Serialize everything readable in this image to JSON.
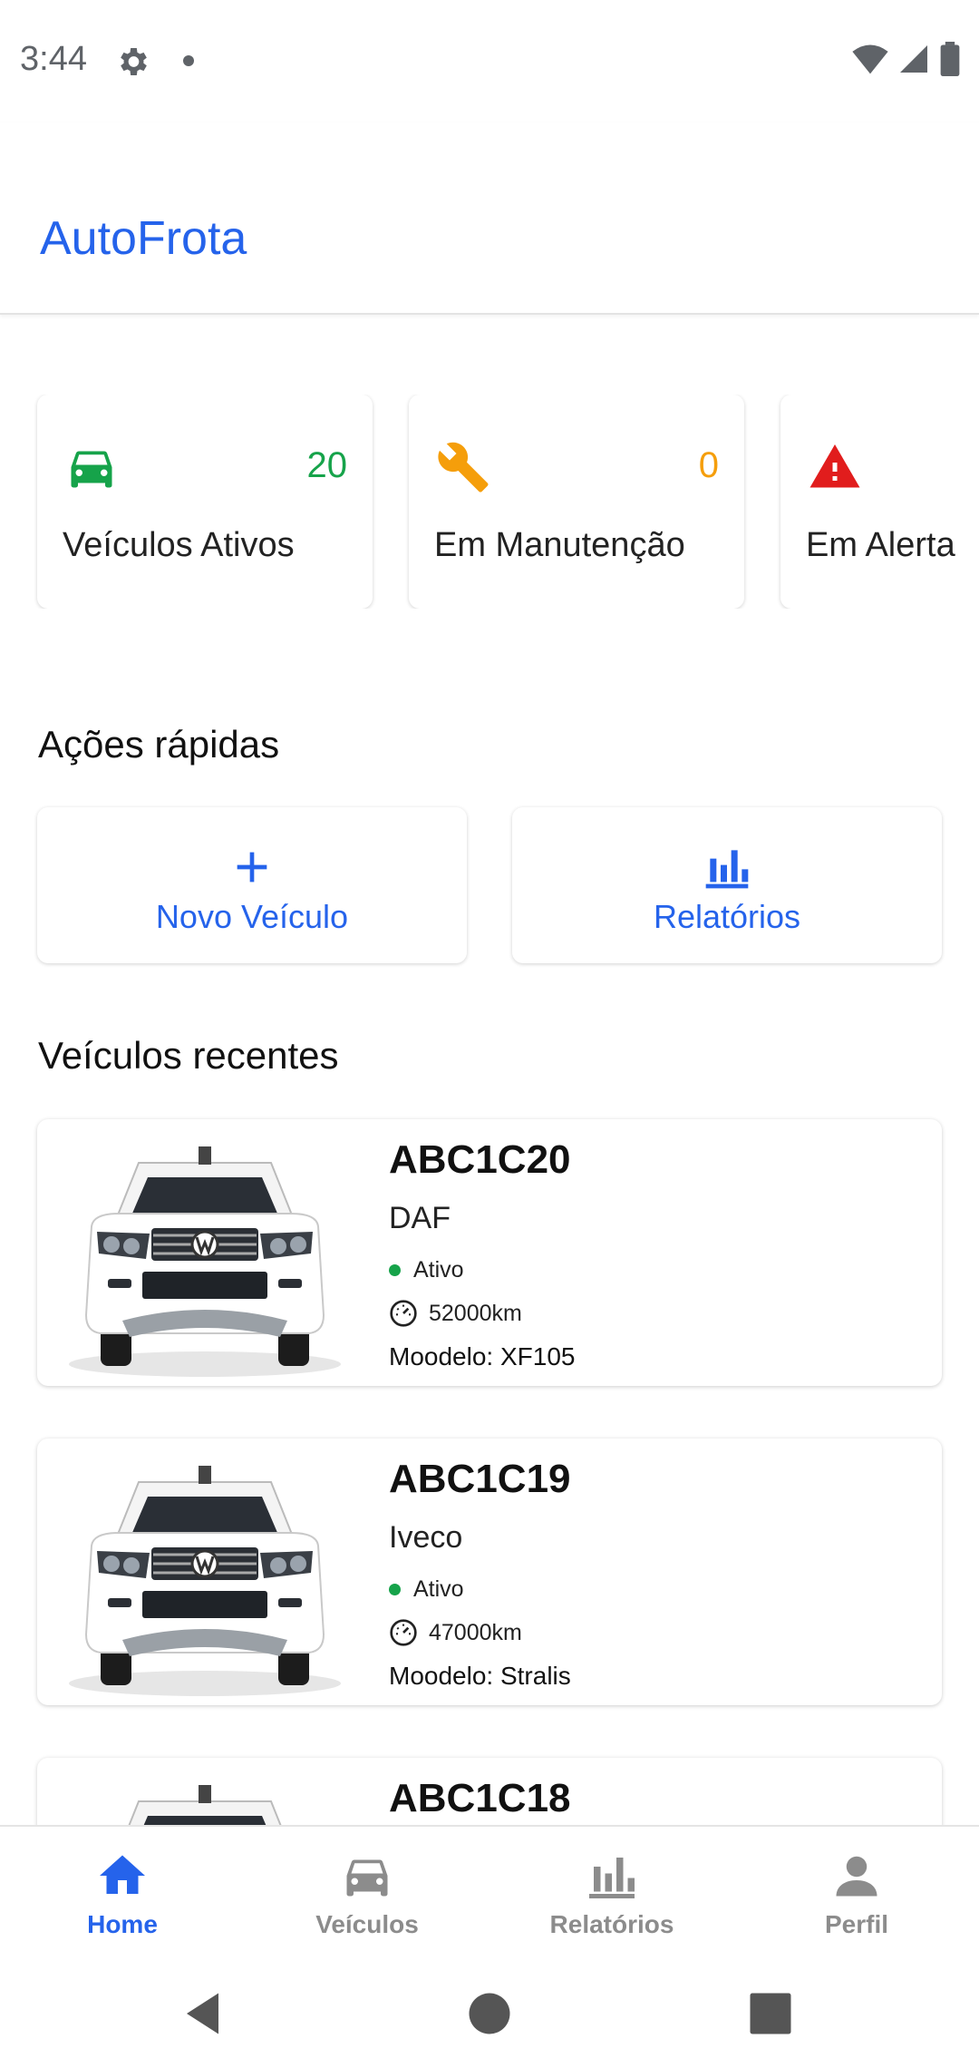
{
  "status_bar": {
    "time": "3:44"
  },
  "app": {
    "title": "AutoFrota"
  },
  "stats": [
    {
      "icon": "car-icon",
      "count": "20",
      "label": "Veículos Ativos",
      "color": "#16a34a"
    },
    {
      "icon": "wrench-icon",
      "count": "0",
      "label": "Em Manutenção",
      "color": "#f59e0b"
    },
    {
      "icon": "alert-icon",
      "count": "",
      "label": "Em Alerta",
      "color": "#e11d1d"
    }
  ],
  "quick_actions": {
    "title": "Ações rápidas",
    "items": [
      {
        "icon": "plus-icon",
        "label": "Novo Veículo"
      },
      {
        "icon": "bar-chart-icon",
        "label": "Relatórios"
      }
    ]
  },
  "recent": {
    "title": "Veículos recentes",
    "vehicles": [
      {
        "plate": "ABC1C20",
        "brand": "DAF",
        "status": "Ativo",
        "km": "52000km",
        "model": "Moodelo: XF105"
      },
      {
        "plate": "ABC1C19",
        "brand": "Iveco",
        "status": "Ativo",
        "km": "47000km",
        "model": "Moodelo: Stralis"
      },
      {
        "plate": "ABC1C18",
        "brand": "",
        "status": "",
        "km": "",
        "model": ""
      }
    ]
  },
  "bottom_nav": [
    {
      "icon": "home-icon",
      "label": "Home",
      "active": true
    },
    {
      "icon": "car-icon",
      "label": "Veículos",
      "active": false
    },
    {
      "icon": "bar-chart-icon",
      "label": "Relatórios",
      "active": false
    },
    {
      "icon": "person-icon",
      "label": "Perfil",
      "active": false
    }
  ],
  "colors": {
    "accent": "#2563eb",
    "active_status": "#16a34a",
    "inactive_nav": "#8c8c8c"
  }
}
